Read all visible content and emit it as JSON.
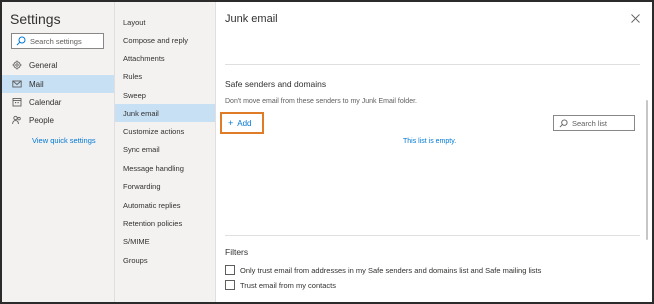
{
  "left": {
    "title": "Settings",
    "search_placeholder": "Search settings",
    "nav": [
      {
        "label": "General",
        "icon": "gear-icon"
      },
      {
        "label": "Mail",
        "icon": "mail-icon"
      },
      {
        "label": "Calendar",
        "icon": "calendar-icon"
      },
      {
        "label": "People",
        "icon": "people-icon"
      }
    ],
    "quick_settings": "View quick settings",
    "active_index": 1
  },
  "middle": {
    "items": [
      "Layout",
      "Compose and reply",
      "Attachments",
      "Rules",
      "Sweep",
      "Junk email",
      "Customize actions",
      "Sync email",
      "Message handling",
      "Forwarding",
      "Automatic replies",
      "Retention policies",
      "S/MIME",
      "Groups"
    ],
    "active_index": 5
  },
  "right": {
    "title": "Junk email",
    "safe_senders": {
      "heading": "Safe senders and domains",
      "description": "Don't move email from these senders to my Junk Email folder.",
      "add_label": "Add",
      "search_placeholder": "Search list",
      "empty_text": "This list is empty."
    },
    "filters": {
      "heading": "Filters",
      "options": [
        {
          "label": "Only trust email from addresses in my Safe senders and domains list and Safe mailing lists",
          "checked": false
        },
        {
          "label": "Trust email from my contacts",
          "checked": false
        }
      ]
    }
  },
  "colors": {
    "accent": "#0078d4",
    "highlight": "#c7e0f4",
    "pane_bg": "#f3f2f1",
    "focus_outline": "#e07b28"
  }
}
